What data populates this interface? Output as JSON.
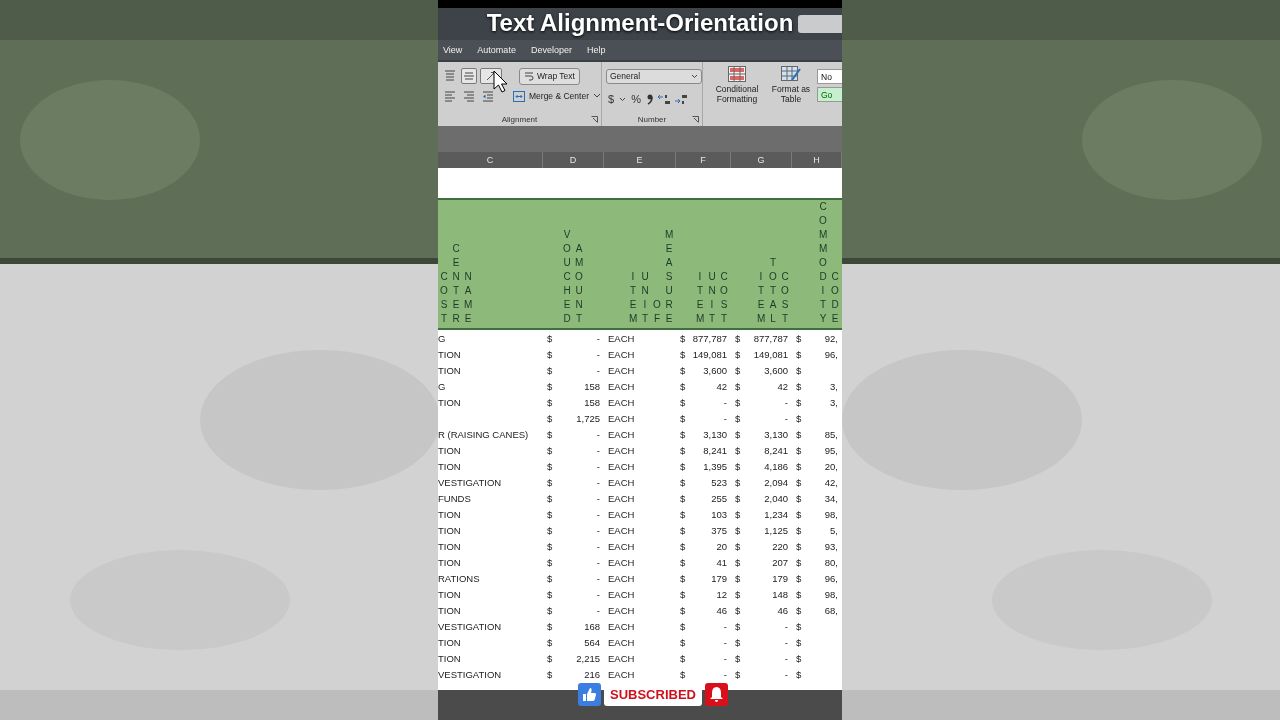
{
  "title_overlay": "Text Alignment-Orientation",
  "menu": [
    "View",
    "Automate",
    "Developer",
    "Help"
  ],
  "ribbon": {
    "vertical_align": [
      {
        "kind": "top",
        "selected": false
      },
      {
        "kind": "middle",
        "selected": true
      }
    ],
    "wrap_text": "Wrap Text",
    "merge": "Merge & Center",
    "alignment_label": "Alignment",
    "number_format": "General",
    "currency": "$",
    "percent": "%",
    "number_label": "Number",
    "conditional": "Conditional Formatting",
    "format_table": "Format as Table",
    "styles": [
      {
        "text": "No",
        "kind": "normal"
      },
      {
        "text": "Go",
        "kind": "good"
      }
    ]
  },
  "column_letters": [
    "C",
    "D",
    "E",
    "F",
    "G",
    "H"
  ],
  "headers": [
    "COST CENTER NAME",
    "VOUCHED AMOUNT",
    "ITEM UNIT OF MEASURE",
    "ITEM UNIT COST",
    "ITEM TOTAL COST",
    "COMMODITY CODE"
  ],
  "rows": [
    [
      "G",
      "$",
      "-",
      "EACH",
      "$",
      "877,787",
      "$",
      "877,787",
      "$",
      "92,"
    ],
    [
      "TION",
      "$",
      "-",
      "EACH",
      "$",
      "149,081",
      "$",
      "149,081",
      "$",
      "96,"
    ],
    [
      "TION",
      "$",
      "-",
      "EACH",
      "$",
      "3,600",
      "$",
      "3,600",
      "$",
      null
    ],
    [
      "G",
      "$",
      "158",
      "EACH",
      "$",
      "42",
      "$",
      "42",
      "$",
      "3,"
    ],
    [
      "TION",
      "$",
      "158",
      "EACH",
      "$",
      "-",
      "$",
      "-",
      "$",
      "3,"
    ],
    [
      null,
      "$",
      "1,725",
      "EACH",
      "$",
      "-",
      "$",
      "-",
      "$",
      null
    ],
    [
      "R (RAISING CANES)",
      "$",
      "-",
      "EACH",
      "$",
      "3,130",
      "$",
      "3,130",
      "$",
      "85,"
    ],
    [
      "TION",
      "$",
      "-",
      "EACH",
      "$",
      "8,241",
      "$",
      "8,241",
      "$",
      "95,"
    ],
    [
      "TION",
      "$",
      "-",
      "EACH",
      "$",
      "1,395",
      "$",
      "4,186",
      "$",
      "20,"
    ],
    [
      "VESTIGATION",
      "$",
      "-",
      "EACH",
      "$",
      "523",
      "$",
      "2,094",
      "$",
      "42,"
    ],
    [
      "FUNDS",
      "$",
      "-",
      "EACH",
      "$",
      "255",
      "$",
      "2,040",
      "$",
      "34,"
    ],
    [
      "TION",
      "$",
      "-",
      "EACH",
      "$",
      "103",
      "$",
      "1,234",
      "$",
      "98,"
    ],
    [
      "TION",
      "$",
      "-",
      "EACH",
      "$",
      "375",
      "$",
      "1,125",
      "$",
      "5,"
    ],
    [
      "TION",
      "$",
      "-",
      "EACH",
      "$",
      "20",
      "$",
      "220",
      "$",
      "93,"
    ],
    [
      "TION",
      "$",
      "-",
      "EACH",
      "$",
      "41",
      "$",
      "207",
      "$",
      "80,"
    ],
    [
      "RATIONS",
      "$",
      "-",
      "EACH",
      "$",
      "179",
      "$",
      "179",
      "$",
      "96,"
    ],
    [
      "TION",
      "$",
      "-",
      "EACH",
      "$",
      "12",
      "$",
      "148",
      "$",
      "98,"
    ],
    [
      "TION",
      "$",
      "-",
      "EACH",
      "$",
      "46",
      "$",
      "46",
      "$",
      "68,"
    ],
    [
      "VESTIGATION",
      "$",
      "168",
      "EACH",
      "$",
      "-",
      "$",
      "-",
      "$",
      null
    ],
    [
      "TION",
      "$",
      "564",
      "EACH",
      "$",
      "-",
      "$",
      "-",
      "$",
      null
    ],
    [
      "TION",
      "$",
      "2,215",
      "EACH",
      "$",
      "-",
      "$",
      "-",
      "$",
      null
    ],
    [
      "VESTIGATION",
      "$",
      "216",
      "EACH",
      "$",
      "-",
      "$",
      "-",
      "$",
      null
    ]
  ],
  "overlay": {
    "subscribe": "SUBSCRIBED"
  }
}
